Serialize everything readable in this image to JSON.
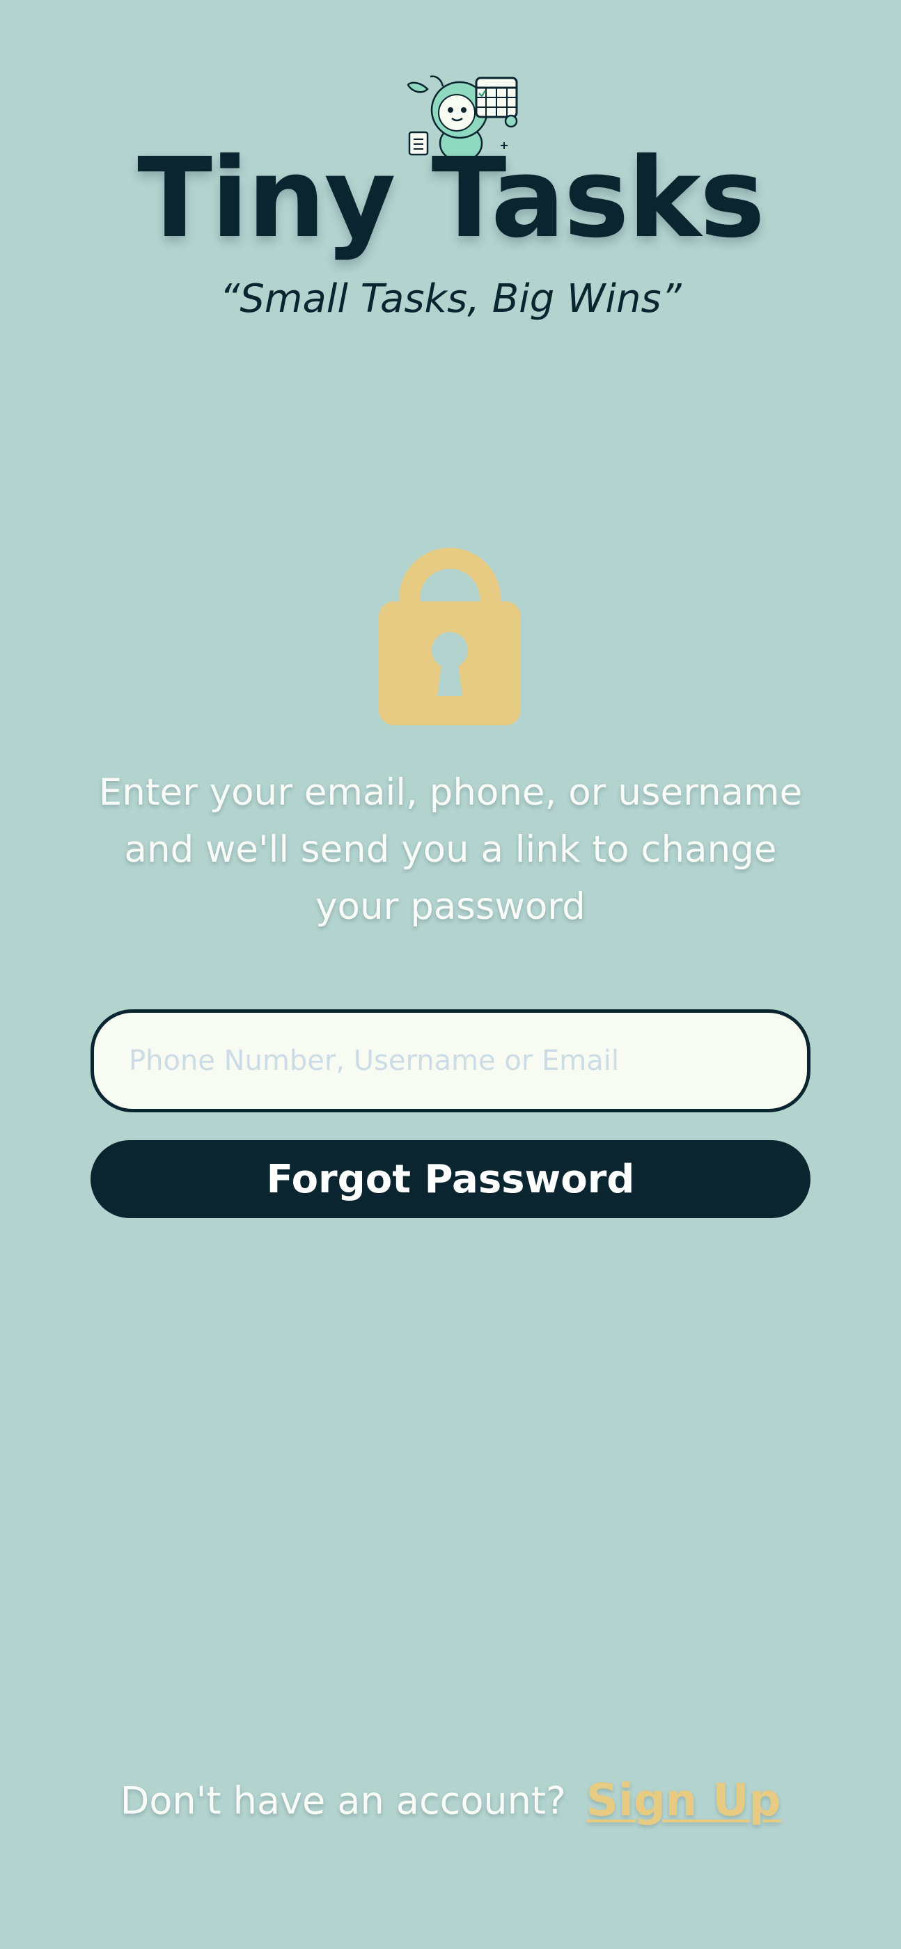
{
  "header": {
    "title": "Tiny Tasks",
    "tagline": "“Small Tasks, Big Wins”",
    "logo_icon": "mascot-calendar-icon"
  },
  "main": {
    "lock_icon": "lock-icon",
    "instructions": "Enter your email, phone, or username and we'll send you a link to change your password",
    "identity_input": {
      "value": "",
      "placeholder": "Phone Number, Username or Email"
    },
    "submit_label": "Forgot Password"
  },
  "footer": {
    "prompt": "Don't have an account?",
    "signup_label": "Sign Up"
  },
  "colors": {
    "background": "#b3d3cf",
    "primary_dark": "#0a2530",
    "accent_gold": "#e8cb82",
    "input_bg": "#f8fbf1"
  }
}
